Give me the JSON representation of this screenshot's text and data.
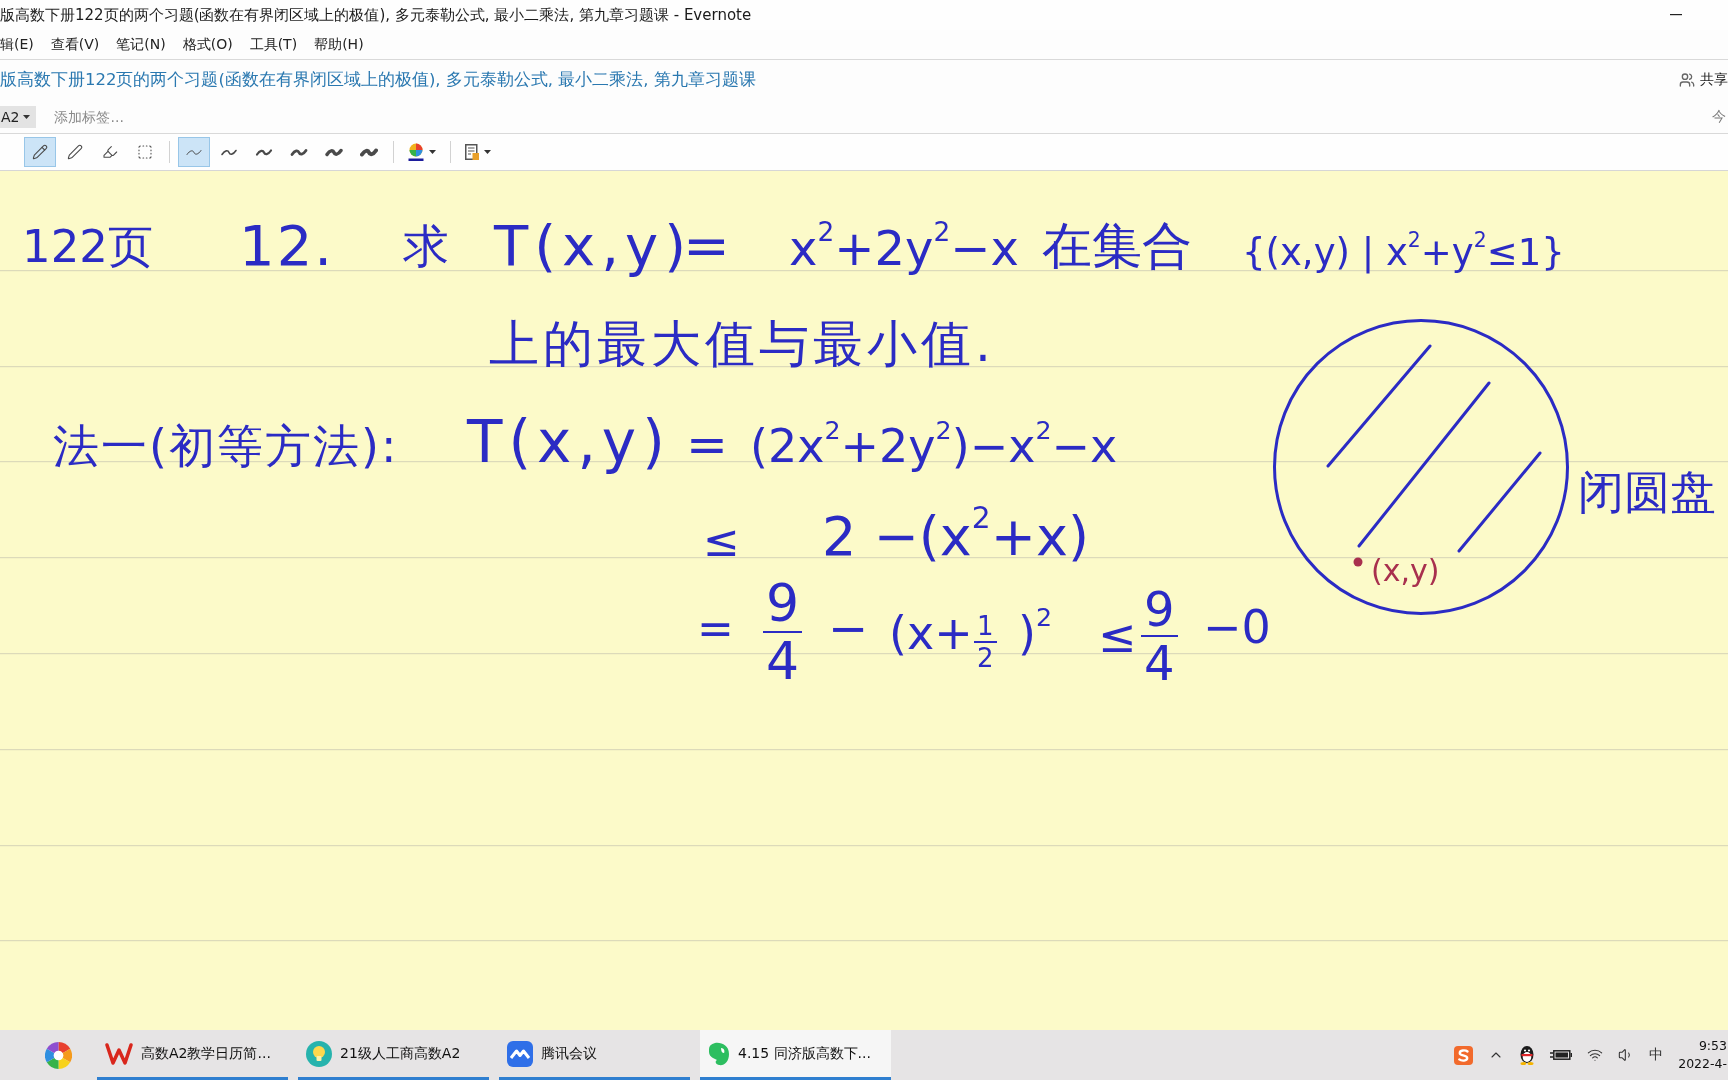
{
  "window": {
    "title": "版高数下册122页的两个习题(函数在有界闭区域上的极值), 多元泰勒公式, 最小二乘法, 第九章习题课 - Evernote"
  },
  "menu_bar": {
    "items": [
      "辑(E)",
      "查看(V)",
      "笔记(N)",
      "格式(O)",
      "工具(T)",
      "帮助(H)"
    ]
  },
  "note": {
    "title": "版高数下册122页的两个习题(函数在有界闭区域上的极值), 多元泰勒公式, 最小二乘法, 第九章习题课",
    "share_label": "共享",
    "notebook": "A2",
    "tag_input": {
      "placeholder": "添加标签..."
    },
    "date_fragment": "今"
  },
  "ink_toolbar": {
    "tools": [
      {
        "kind": "pencil",
        "selected": true
      },
      {
        "kind": "pen",
        "selected": false
      },
      {
        "kind": "marker",
        "selected": false
      },
      {
        "kind": "select",
        "selected": false
      }
    ],
    "stroke_widths": [
      {
        "selected": true
      },
      {
        "selected": false
      },
      {
        "selected": false
      },
      {
        "selected": false
      },
      {
        "selected": false
      },
      {
        "selected": false
      }
    ]
  },
  "ink_page": {
    "phrases": [
      {
        "kind": "text",
        "text": "122页"
      },
      {
        "kind": "text",
        "text": "12."
      },
      {
        "kind": "text",
        "text": "求"
      },
      {
        "kind": "text",
        "text": "T(x,y)"
      },
      {
        "kind": "text",
        "text": "="
      },
      {
        "kind": "text",
        "text": "x$^{2}$+2y$^{2}$−x"
      },
      {
        "kind": "text",
        "text": "在集合"
      },
      {
        "kind": "text",
        "text": "{(x,y) | x$^{2}$+y$^{2}$≤1}"
      },
      {
        "kind": "text",
        "text": "上的最大值与最小值."
      },
      {
        "kind": "text",
        "text": "法一(初等方法):"
      },
      {
        "kind": "text",
        "text": "T(x,y)"
      },
      {
        "kind": "text",
        "text": "="
      },
      {
        "kind": "text",
        "text": "(2x$^{2}$+2y$^{2}$)−x$^{2}$−x"
      },
      {
        "kind": "text",
        "text": "≤"
      },
      {
        "kind": "text",
        "text": "2 −(x$^{2}$+x)"
      },
      {
        "kind": "text",
        "text": "="
      },
      {
        "kind": "fraction",
        "numerator": "9",
        "denominator": "4"
      },
      {
        "kind": "text",
        "text": "−"
      },
      {
        "kind": "text",
        "text": "(x+"
      },
      {
        "kind": "fraction",
        "numerator": "1",
        "denominator": "2"
      },
      {
        "kind": "text",
        "text": ")$^{2}$"
      },
      {
        "kind": "text",
        "text": "≤"
      },
      {
        "kind": "fraction",
        "numerator": "9",
        "denominator": "4"
      },
      {
        "kind": "text",
        "text": "−0"
      }
    ],
    "diagram": {
      "point_label": "(x,y)",
      "caption": "闭圆盘"
    }
  },
  "taskbar": {
    "pinned": [
      {
        "kind": "color-wheel"
      }
    ],
    "apps": [
      {
        "kind": "wps",
        "label": "高数A2教学日历简...",
        "selected": false
      },
      {
        "kind": "bulb",
        "label": "21级人工商高数A2",
        "selected": false
      },
      {
        "kind": "meeting",
        "label": "腾讯会议",
        "selected": false
      },
      {
        "kind": "elephant",
        "label": "4.15 同济版高数下...",
        "selected": true
      }
    ],
    "tray_icons": [
      {
        "kind": "sogou"
      },
      {
        "kind": "chevron"
      },
      {
        "kind": "penguin"
      },
      {
        "kind": "battery"
      },
      {
        "kind": "wifi"
      },
      {
        "kind": "speaker"
      }
    ],
    "ime": "中",
    "time": "9:53",
    "date": "2022-4-"
  }
}
